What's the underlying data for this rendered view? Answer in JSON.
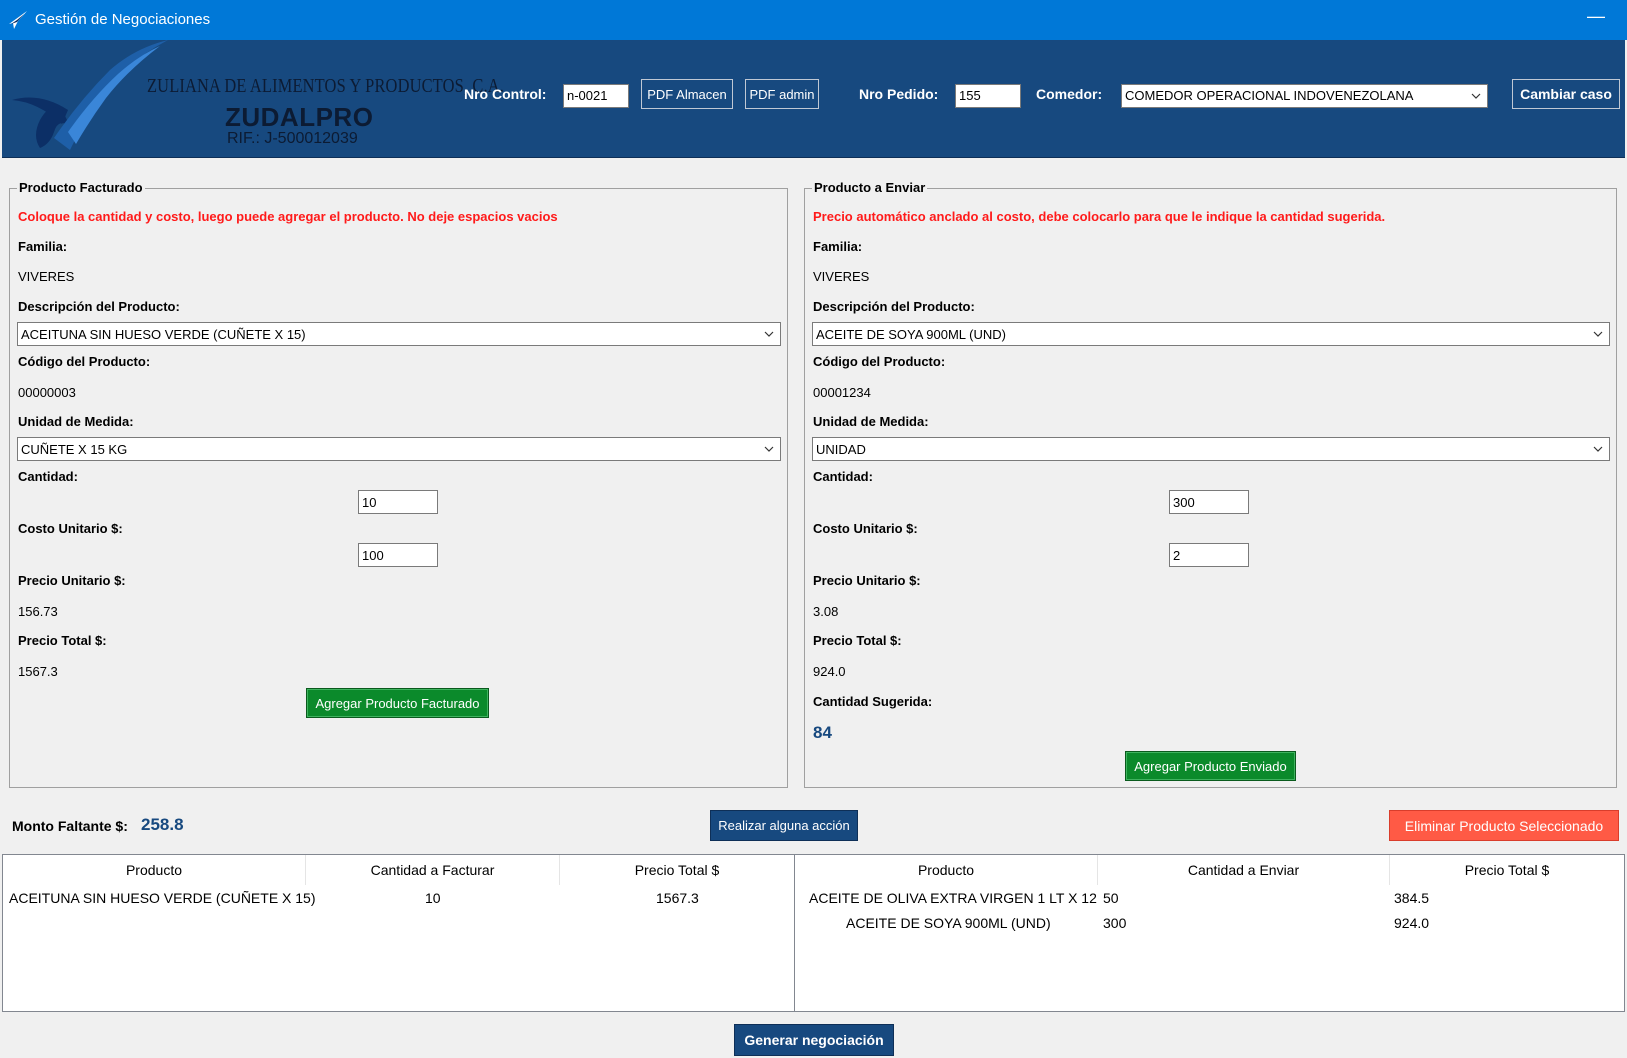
{
  "window": {
    "title": "Gestión de Negociaciones",
    "minimize_glyph": "—"
  },
  "header": {
    "company_name": "ZULIANA DE ALIMENTOS Y PRODUCTOS, C.A.",
    "brand": "ZUDALPRO",
    "rif": "RIF.: J-500012039",
    "nro_control_label": "Nro Control:",
    "nro_control_value": "n-0021",
    "pdf_almacen_label": "PDF Almacen",
    "pdf_admin_label": "PDF admin",
    "nro_pedido_label": "Nro Pedido:",
    "nro_pedido_value": "155",
    "comedor_label": "Comedor:",
    "comedor_value": "COMEDOR OPERACIONAL INDOVENEZOLANA",
    "cambiar_caso_label": "Cambiar caso"
  },
  "facturado": {
    "group_title": "Producto Facturado",
    "warning": "Coloque la cantidad y costo, luego puede agregar el producto. No deje espacios vacios",
    "familia_label": "Familia:",
    "familia_value": "VIVERES",
    "descripcion_label": "Descripción del Producto:",
    "descripcion_value": "ACEITUNA SIN HUESO VERDE (CUÑETE X 15)",
    "codigo_label": "Código del Producto:",
    "codigo_value": "00000003",
    "unidad_label": "Unidad de Medida:",
    "unidad_value": "CUÑETE X 15 KG",
    "cantidad_label": "Cantidad:",
    "cantidad_value": "10",
    "costo_label": "Costo Unitario $:",
    "costo_value": "100",
    "precio_unitario_label": "Precio Unitario $:",
    "precio_unitario_value": "156.73",
    "precio_total_label": "Precio Total $:",
    "precio_total_value": "1567.3",
    "agregar_label": "Agregar Producto Facturado"
  },
  "enviar": {
    "group_title": "Producto a Enviar",
    "warning": "Precio automático anclado al costo, debe colocarlo para que le indique la cantidad sugerida.",
    "familia_label": "Familia:",
    "familia_value": "VIVERES",
    "descripcion_label": "Descripción del Producto:",
    "descripcion_value": "ACEITE DE SOYA 900ML (UND)",
    "codigo_label": "Código del Producto:",
    "codigo_value": "00001234",
    "unidad_label": "Unidad de Medida:",
    "unidad_value": "UNIDAD",
    "cantidad_label": "Cantidad:",
    "cantidad_value": "300",
    "costo_label": "Costo Unitario $:",
    "costo_value": "2",
    "precio_unitario_label": "Precio Unitario $:",
    "precio_unitario_value": "3.08",
    "precio_total_label": "Precio Total $:",
    "precio_total_value": "924.0",
    "sugerida_label": "Cantidad Sugerida:",
    "sugerida_value": "84",
    "agregar_label": "Agregar Producto Enviado"
  },
  "actions": {
    "monto_faltante_label": "Monto Faltante $:",
    "monto_faltante_value": "258.8",
    "realizar_label": "Realizar alguna acción",
    "eliminar_label": "Eliminar Producto Seleccionado",
    "generar_label": "Generar negociación"
  },
  "tabla_facturar": {
    "headers": [
      "Producto",
      "Cantidad a Facturar",
      "Precio Total $"
    ],
    "rows": [
      [
        "ACEITUNA SIN HUESO VERDE (CUÑETE X 15)",
        "10",
        "1567.3"
      ]
    ]
  },
  "tabla_enviar": {
    "headers": [
      "Producto",
      "Cantidad a Enviar",
      "Precio Total $"
    ],
    "rows": [
      [
        "ACEITE DE OLIVA EXTRA VIRGEN 1 LT X 12",
        "50",
        "384.5"
      ],
      [
        "ACEITE DE SOYA 900ML (UND)",
        "300",
        "924.0"
      ]
    ]
  }
}
